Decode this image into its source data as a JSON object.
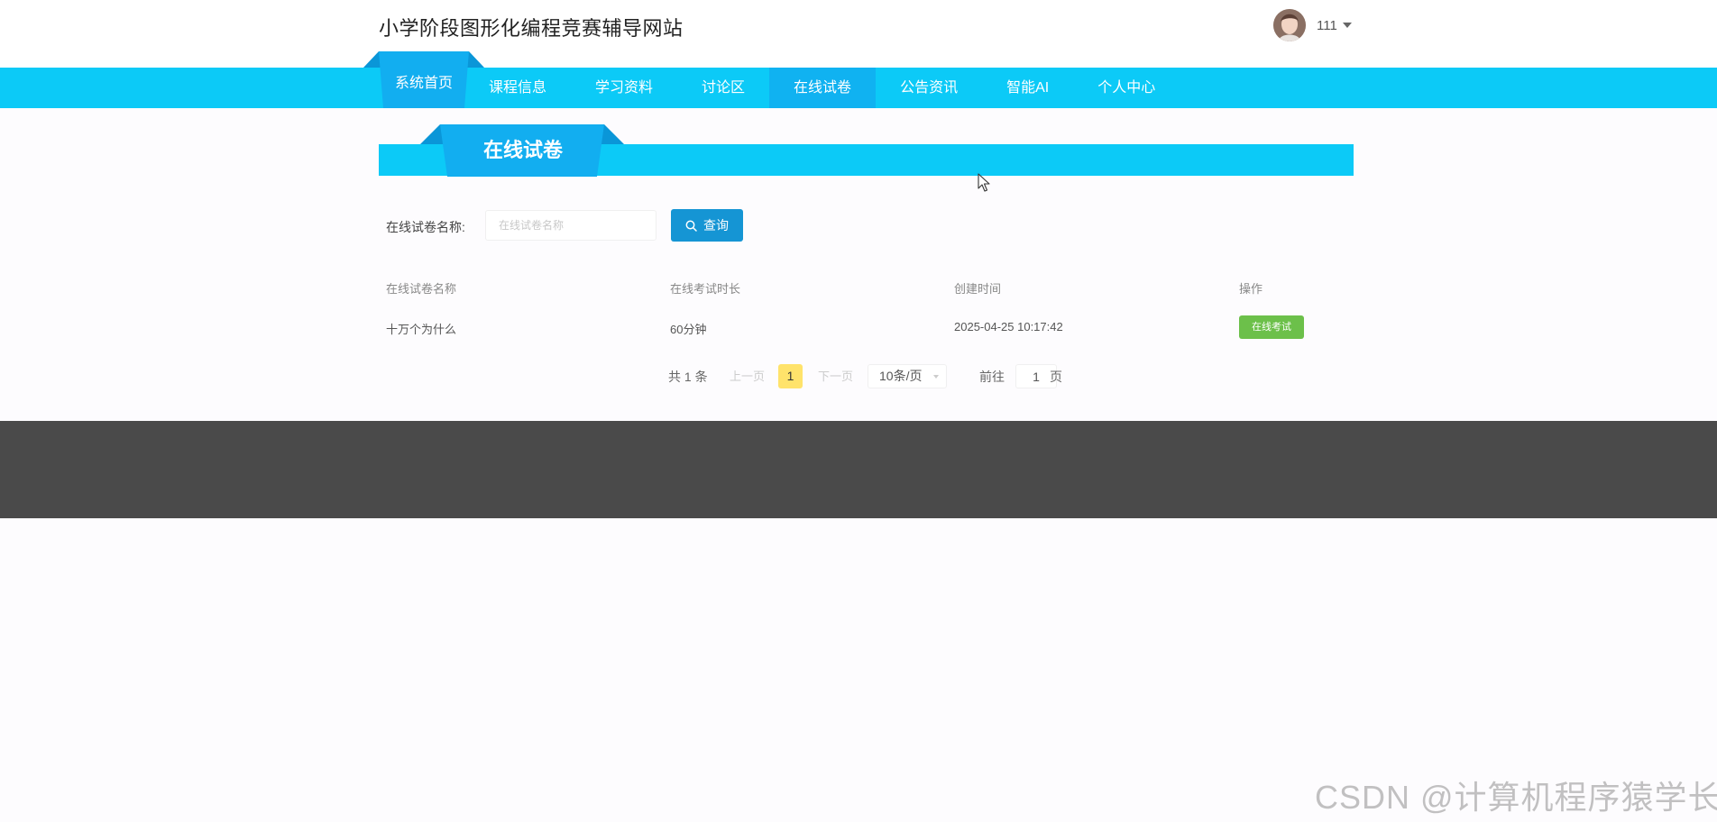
{
  "header": {
    "site_title": "小学阶段图形化编程竞赛辅导网站",
    "username": "111"
  },
  "nav": {
    "items": [
      {
        "label": "系统首页"
      },
      {
        "label": "课程信息"
      },
      {
        "label": "学习资料"
      },
      {
        "label": "讨论区"
      },
      {
        "label": "在线试卷"
      },
      {
        "label": "公告资讯"
      },
      {
        "label": "智能AI"
      },
      {
        "label": "个人中心"
      }
    ],
    "active_index": 4
  },
  "section": {
    "title": "在线试卷"
  },
  "search": {
    "label": "在线试卷名称:",
    "placeholder": "在线试卷名称",
    "value": "",
    "button_label": "查询"
  },
  "table": {
    "headers": [
      "在线试卷名称",
      "在线考试时长",
      "创建时间",
      "操作"
    ],
    "rows": [
      {
        "name": "十万个为什么",
        "duration": "60分钟",
        "created": "2025-04-25 10:17:42",
        "action_label": "在线考试"
      }
    ]
  },
  "pagination": {
    "total_text": "共 1 条",
    "prev_label": "上一页",
    "current_page": "1",
    "next_label": "下一页",
    "page_size_label": "10条/页",
    "goto_label": "前往",
    "goto_value": "1",
    "page_unit": "页"
  },
  "watermark": "CSDN @计算机程序猿学长",
  "colors": {
    "nav_bg": "#0ccaf7",
    "nav_active": "#10b2f1",
    "search_button": "#1595d4",
    "action_button": "#6cc04a",
    "current_page": "#ffe36b",
    "footer": "#4a4a4a"
  }
}
